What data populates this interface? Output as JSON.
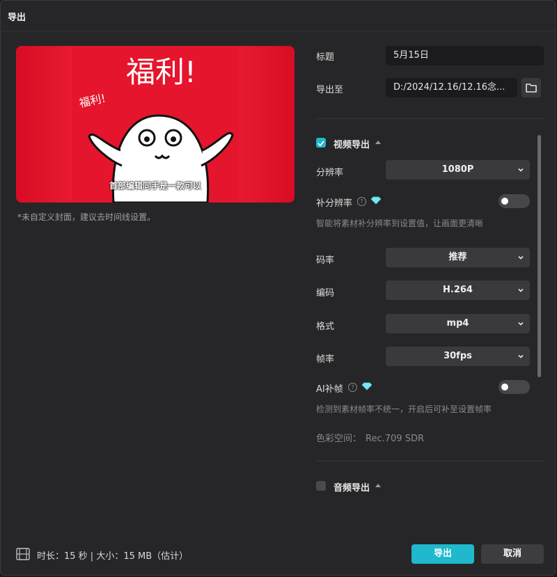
{
  "window": {
    "title": "导出"
  },
  "preview": {
    "caption": "首部编辑同手是一款可以",
    "headline": "福利!",
    "small_headline": "福利!",
    "cover_note": "*未自定义封面，建议去时间线设置。"
  },
  "form": {
    "title_label": "标题",
    "title_value": "5月15日",
    "export_to_label": "导出至",
    "export_to_value": "D:/2024/12.16/12.16念..."
  },
  "video": {
    "section_title": "视频导出",
    "checked": true,
    "resolution_label": "分辨率",
    "resolution_value": "1080P",
    "super_res_label": "补分辨率",
    "super_res_hint": "智能将素材补分辨率到设置值，让画面更清晰",
    "bitrate_label": "码率",
    "bitrate_value": "推荐",
    "codec_label": "编码",
    "codec_value": "H.264",
    "format_label": "格式",
    "format_value": "mp4",
    "framerate_label": "帧率",
    "framerate_value": "30fps",
    "ai_frame_label": "AI补帧",
    "ai_frame_hint": "检测到素材帧率不统一，开启后可补至设置帧率",
    "color_space_label": "色彩空间：",
    "color_space_value": "Rec.709 SDR"
  },
  "audio": {
    "section_title": "音频导出",
    "checked": false
  },
  "footer": {
    "info": "时长：15 秒 | 大小：15 MB（估计）",
    "export_button": "导出",
    "cancel_button": "取消"
  },
  "colors": {
    "accent": "#1fb8cc",
    "background": "#262628",
    "preview_red": "#e4152c"
  }
}
